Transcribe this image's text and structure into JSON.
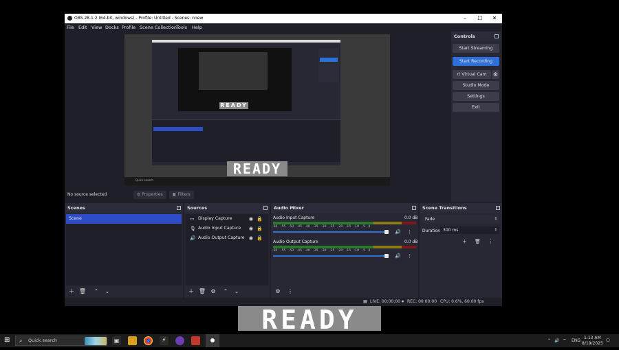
{
  "window": {
    "title": "OBS 28.1.2 (64-bit, windows) - Profile: Untitled - Scenes: nnew",
    "controls": {
      "minimize": "–",
      "maximize": "☐",
      "close": "✕"
    }
  },
  "menu": [
    "File",
    "Edit",
    "View",
    "Docks",
    "Profile",
    "Scene Collection",
    "Tools",
    "Help"
  ],
  "preview": {
    "overlay_text": "READY",
    "nested_overlay_text": "READY",
    "taskbar_search": "Quick search"
  },
  "source_bar": {
    "status": "No source selected",
    "properties": "Properties",
    "filters": "Filters"
  },
  "controls_dock": {
    "title": "Controls",
    "buttons": [
      "Start Streaming",
      "Start Recording",
      "rt Virtual Cam",
      "Studio Mode",
      "Settings",
      "Exit"
    ]
  },
  "scenes_dock": {
    "title": "Scenes",
    "items": [
      "Scene"
    ]
  },
  "sources_dock": {
    "title": "Sources",
    "items": [
      {
        "label": "Display Capture",
        "icon": "monitor-icon"
      },
      {
        "label": "Audio Input Capture",
        "icon": "microphone-icon"
      },
      {
        "label": "Audio Output Capture",
        "icon": "speaker-icon"
      }
    ]
  },
  "mixer_dock": {
    "title": "Audio Mixer",
    "channels": [
      {
        "name": "Audio Input Capture",
        "level": "0.0 dB",
        "volume_fraction": 0.97
      },
      {
        "name": "Audio Output Capture",
        "level": "0.0 dB",
        "volume_fraction": 0.97
      }
    ],
    "ticks": [
      "-60",
      "-55",
      "-50",
      "-45",
      "-40",
      "-35",
      "-30",
      "-25",
      "-20",
      "-15",
      "-10",
      "-5",
      "0"
    ]
  },
  "transitions_dock": {
    "title": "Scene Transitions",
    "transition": "Fade",
    "duration_label": "Duration",
    "duration_value": "300 ms"
  },
  "statusbar": {
    "live": "LIVE: 00:00:00",
    "rec": "REC: 00:00:00",
    "cpu": "CPU: 0.6%, 60.00 fps"
  },
  "bottom_overlay": "READY",
  "taskbar": {
    "search_placeholder": "Quick search",
    "time": "1:13 AM",
    "date": "8/19/2025",
    "language": "ENG"
  },
  "colors": {
    "accent": "#2f6fd8",
    "panel": "#272833",
    "background": "#1e1f29"
  }
}
